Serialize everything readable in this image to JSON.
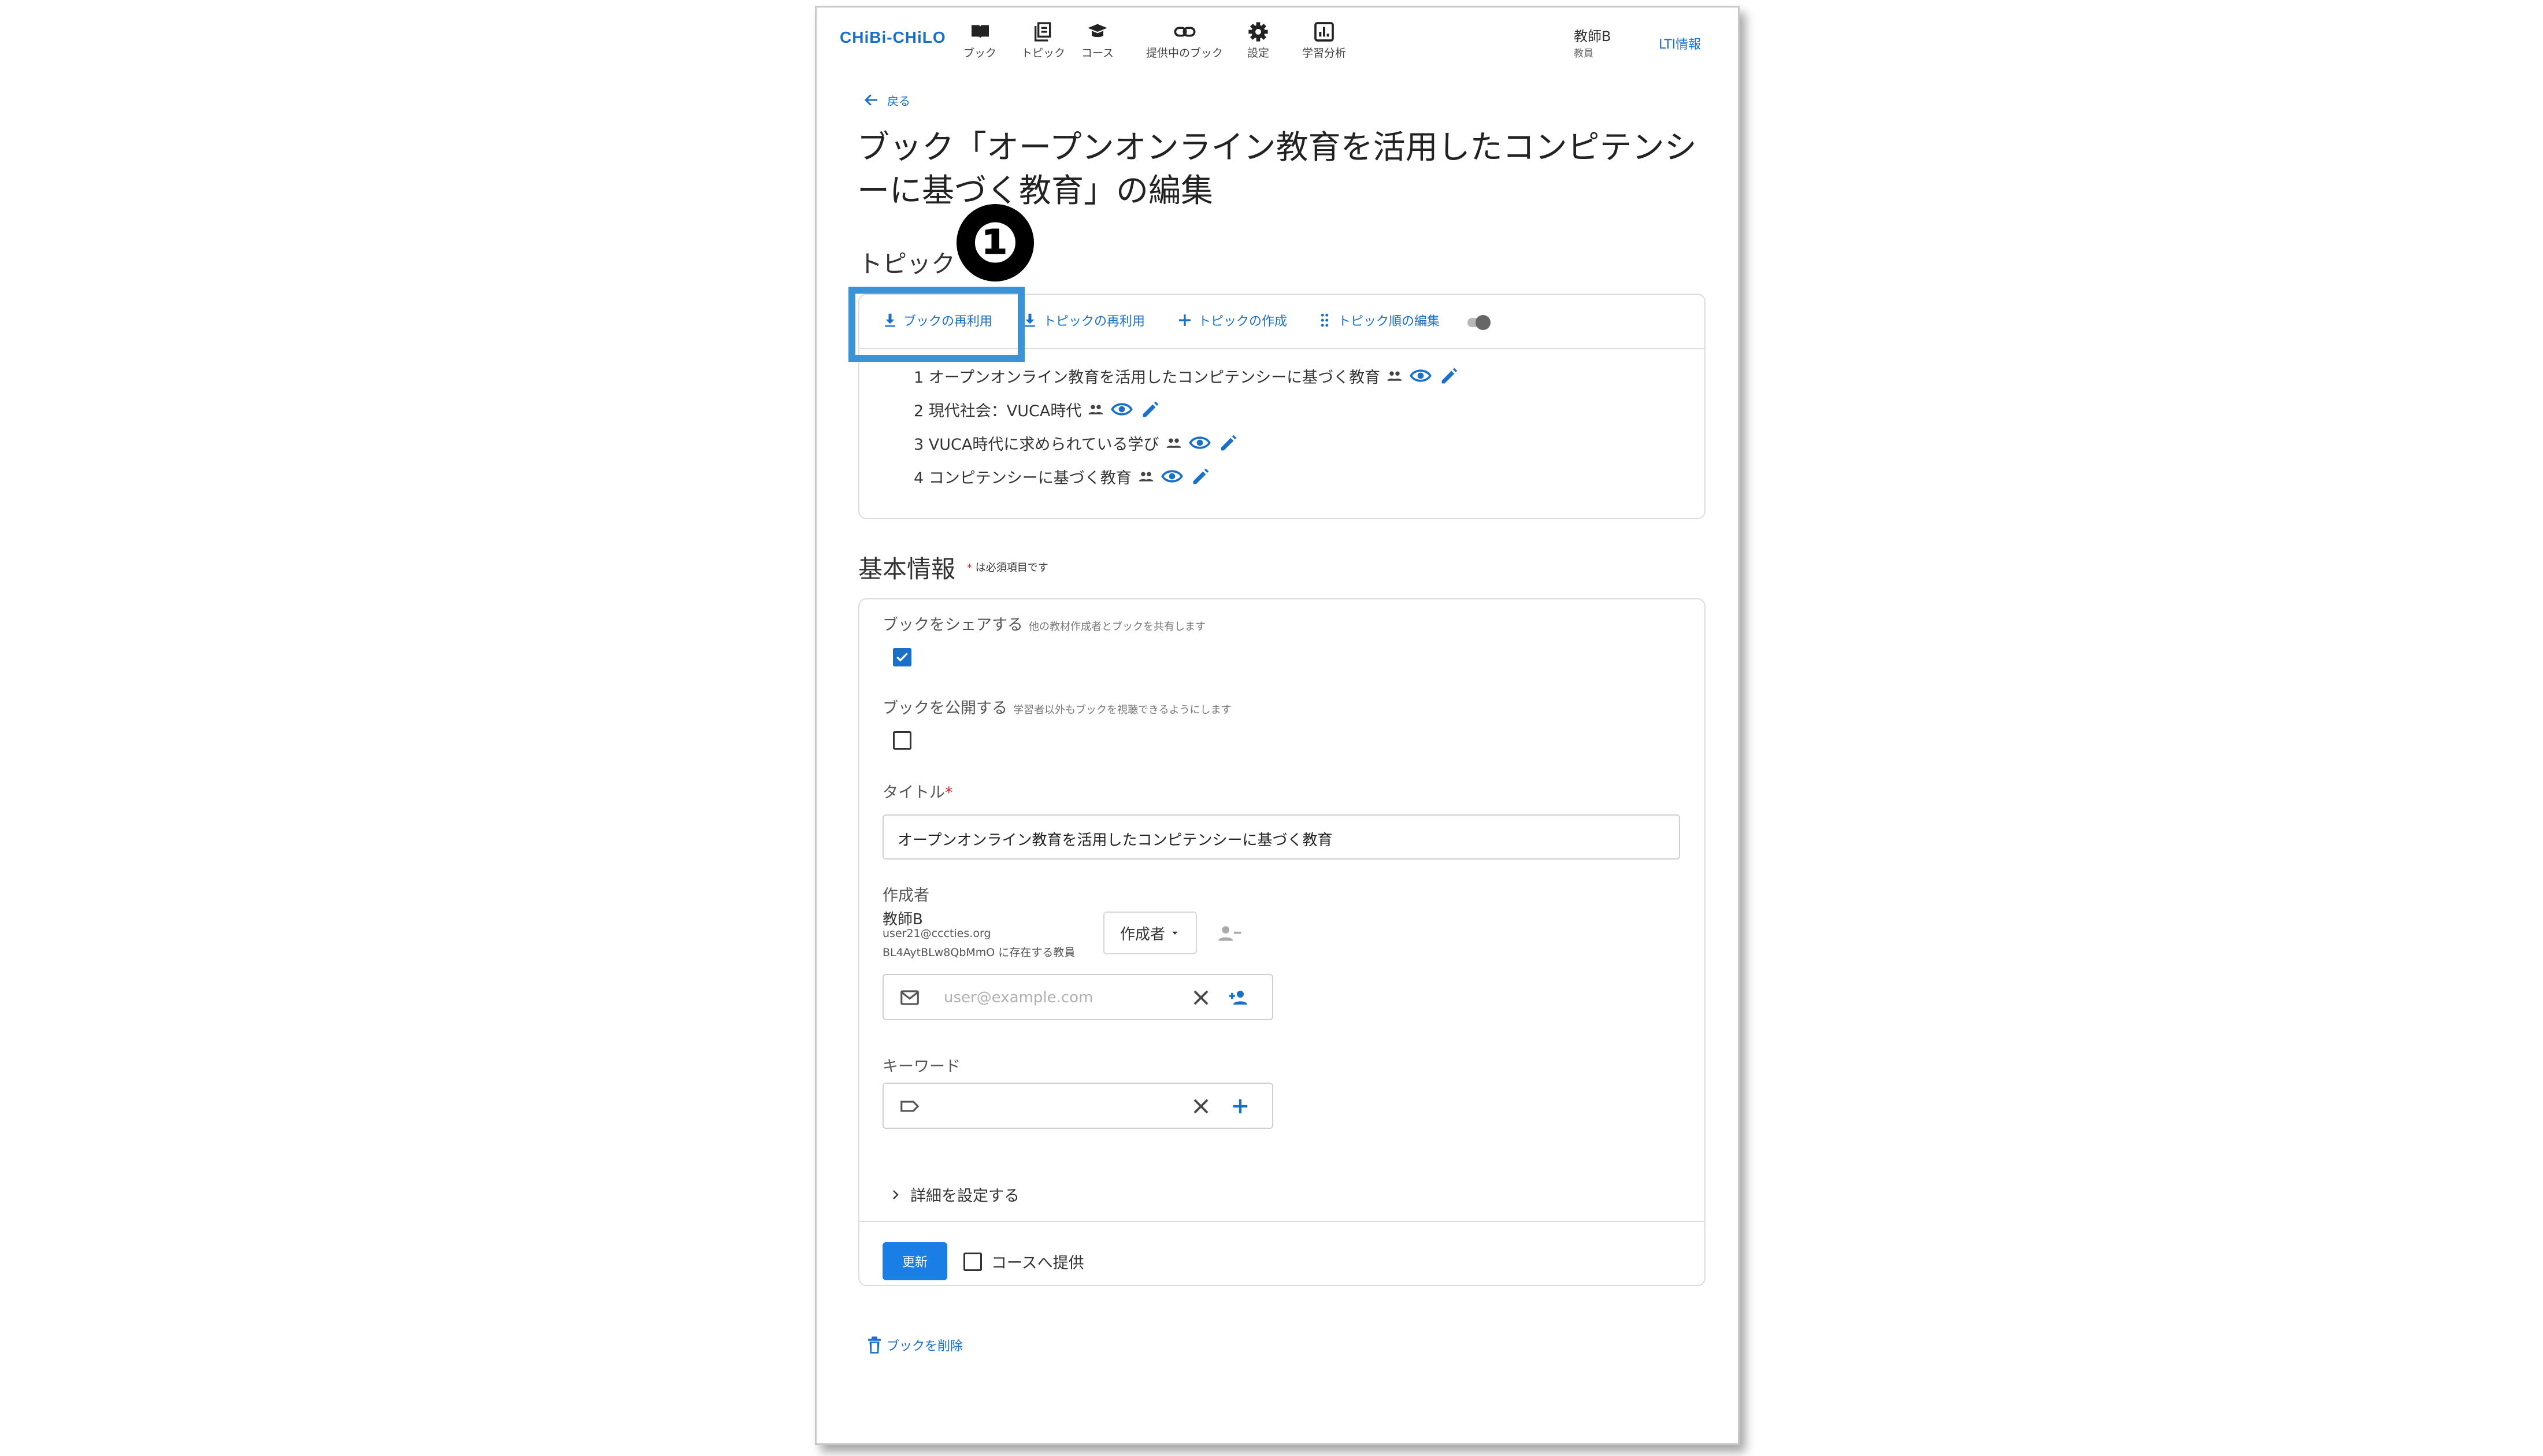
{
  "header": {
    "logo": "CHiBi-CHiLO",
    "nav": [
      {
        "label": "ブック",
        "icon": "book-icon"
      },
      {
        "label": "トピック",
        "icon": "topic-icon"
      },
      {
        "label": "コース",
        "icon": "course-icon"
      },
      {
        "label": "提供中のブック",
        "icon": "link-icon"
      },
      {
        "label": "設定",
        "icon": "gear-icon"
      },
      {
        "label": "学習分析",
        "icon": "analytics-icon"
      }
    ],
    "user_name": "教師B",
    "user_role": "教員",
    "lti_link": "LTI情報"
  },
  "back_label": "戻る",
  "page_title": "ブック「オープンオンライン教育を活用したコンピテンシーに基づく教育」の編集",
  "topics_section": {
    "title": "トピック",
    "callout_number": "❶",
    "toolbar": {
      "reuse_book": "ブックの再利用",
      "reuse_topic": "トピックの再利用",
      "create_topic": "トピックの作成",
      "edit_order": "トピック順の編集"
    },
    "items": [
      {
        "label": "1 オープンオンライン教育を活用したコンピテンシーに基づく教育"
      },
      {
        "label": "2 現代社会：VUCA時代"
      },
      {
        "label": "3 VUCA時代に求められている学び"
      },
      {
        "label": "4 コンピテンシーに基づく教育"
      }
    ]
  },
  "basic_info": {
    "title": "基本情報",
    "required_mark": "*",
    "required_note": "は必須項目です",
    "share": {
      "label": "ブックをシェアする",
      "hint": "他の教材作成者とブックを共有します",
      "checked": true
    },
    "publish": {
      "label": "ブックを公開する",
      "hint": "学習者以外もブックを視聴できるようにします",
      "checked": false
    },
    "title_field": {
      "label": "タイトル",
      "required_mark": "*",
      "value": "オープンオンライン教育を活用したコンピテンシーに基づく教育"
    },
    "authors": {
      "label": "作成者",
      "name": "教師B",
      "email": "user21@cccties.org",
      "id_text": "BL4AytBLw8QbMmO に存在する教員",
      "role": "作成者",
      "email_placeholder": "user@example.com"
    },
    "keywords": {
      "label": "キーワード",
      "placeholder": ""
    },
    "details_label": "詳細を設定する",
    "update_button": "更新",
    "course_offer": {
      "label": "コースへ提供",
      "checked": false
    }
  },
  "delete_book": "ブックを削除",
  "colors": {
    "accent": "#1a6fc9",
    "highlight": "#3a93d6",
    "required": "#d32f2f"
  }
}
